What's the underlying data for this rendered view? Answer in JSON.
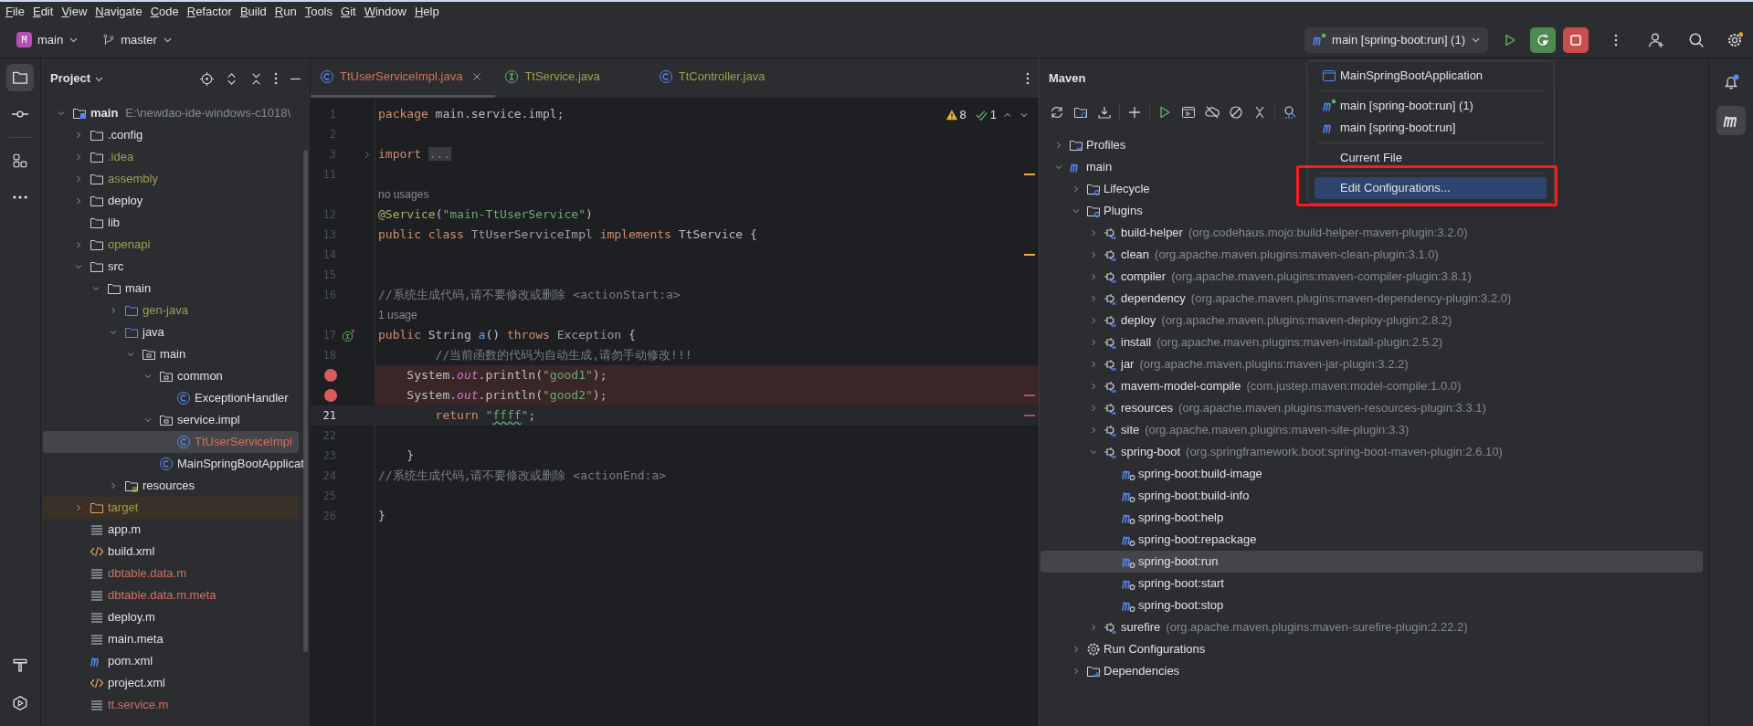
{
  "menu": [
    "File",
    "Edit",
    "View",
    "Navigate",
    "Code",
    "Refactor",
    "Build",
    "Run",
    "Tools",
    "Git",
    "Window",
    "Help"
  ],
  "toolbar": {
    "project": {
      "badge": "M",
      "label": "main"
    },
    "branch": "master",
    "run_config": "main [spring-boot:run] (1)",
    "running": true
  },
  "left_strip": [
    {
      "kind": "project",
      "selected": true
    },
    {
      "kind": "commit",
      "selected": false
    },
    {
      "kind": "structure",
      "selected": false
    },
    {
      "kind": "more",
      "selected": false
    }
  ],
  "left_strip_bottom": [
    {
      "kind": "build"
    },
    {
      "kind": "services"
    }
  ],
  "project": {
    "title": "Project",
    "tree": [
      {
        "kind": "module",
        "label": "main",
        "detail": "E:\\newdao-ide-windows-c1018\\",
        "expanded": true,
        "color": "#dfe1e5",
        "selected": false,
        "children": [
          {
            "kind": "folder",
            "label": ".config",
            "expanded": false,
            "color": "#dfe1e5",
            "selected": false
          },
          {
            "kind": "folder",
            "label": ".idea",
            "expanded": false,
            "color": "#a19f4e",
            "selected": false
          },
          {
            "kind": "folder",
            "label": "assembly",
            "expanded": false,
            "color": "#a19f4e",
            "selected": false
          },
          {
            "kind": "folder",
            "label": "deploy",
            "expanded": false,
            "color": "#dfe1e5",
            "selected": false
          },
          {
            "kind": "folder",
            "label": "lib",
            "color": "#dfe1e5",
            "selected": false
          },
          {
            "kind": "folder",
            "label": "openapi",
            "expanded": false,
            "color": "#a19f4e",
            "selected": false
          },
          {
            "kind": "folder",
            "label": "src",
            "expanded": true,
            "color": "#dfe1e5",
            "selected": false,
            "children": [
              {
                "kind": "folder",
                "label": "main",
                "expanded": true,
                "color": "#dfe1e5",
                "selected": false,
                "children": [
                  {
                    "kind": "source-folder",
                    "label": "gen-java",
                    "expanded": false,
                    "color": "#a19f4e",
                    "selected": false
                  },
                  {
                    "kind": "source-folder",
                    "label": "java",
                    "expanded": true,
                    "color": "#dfe1e5",
                    "selected": false,
                    "children": [
                      {
                        "kind": "package",
                        "label": "main",
                        "expanded": true,
                        "color": "#dfe1e5",
                        "selected": false,
                        "children": [
                          {
                            "kind": "package",
                            "label": "common",
                            "expanded": true,
                            "color": "#dfe1e5",
                            "selected": false,
                            "children": [
                              {
                                "kind": "class",
                                "label": "ExceptionHandler",
                                "color": "#dfe1e5",
                                "selected": false
                              }
                            ]
                          },
                          {
                            "kind": "package",
                            "label": "service.impl",
                            "expanded": true,
                            "color": "#dfe1e5",
                            "selected": false,
                            "children": [
                              {
                                "kind": "class",
                                "label": "TtUserServiceImpl",
                                "color": "#d5705e",
                                "selected": true
                              }
                            ]
                          },
                          {
                            "kind": "class",
                            "label": "MainSpringBootApplicat",
                            "color": "#dfe1e5",
                            "selected": false
                          }
                        ]
                      }
                    ]
                  },
                  {
                    "kind": "resources-folder",
                    "label": "resources",
                    "expanded": false,
                    "color": "#dfe1e5",
                    "selected": false
                  }
                ]
              }
            ]
          },
          {
            "kind": "excluded-folder",
            "label": "target",
            "expanded": false,
            "excluded": true,
            "color": "#a19f4e",
            "selected": false
          },
          {
            "kind": "file",
            "label": "app.m",
            "color": "#dfe1e5",
            "selected": false
          },
          {
            "kind": "xml",
            "label": "build.xml",
            "color": "#dfe1e5",
            "selected": false
          },
          {
            "kind": "file",
            "label": "dbtable.data.m",
            "color": "#d5705e",
            "selected": false
          },
          {
            "kind": "file",
            "label": "dbtable.data.m.meta",
            "color": "#d5705e",
            "selected": false
          },
          {
            "kind": "file",
            "label": "deploy.m",
            "color": "#dfe1e5",
            "selected": false
          },
          {
            "kind": "file",
            "label": "main.meta",
            "color": "#dfe1e5",
            "selected": false
          },
          {
            "kind": "maven",
            "label": "pom.xml",
            "color": "#dfe1e5",
            "selected": false
          },
          {
            "kind": "xml",
            "label": "project.xml",
            "color": "#dfe1e5",
            "selected": false
          },
          {
            "kind": "file",
            "label": "tt.service.m",
            "color": "#d5705e",
            "selected": false
          }
        ]
      }
    ]
  },
  "editor": {
    "tabs": [
      {
        "kind": "class",
        "label": "TtUserServiceImpl.java",
        "color": "#d5705e",
        "selected": true,
        "closable": true
      },
      {
        "kind": "interface",
        "label": "TtService.java",
        "color": "#a19f4e",
        "selected": false,
        "closable": false
      },
      {
        "kind": "class",
        "label": "TtController.java",
        "color": "#a19f4e",
        "selected": false,
        "closable": false
      }
    ],
    "inspections": {
      "warnings": "8",
      "passed": "1"
    },
    "lines": [
      {
        "kind": "code",
        "number": "1",
        "tokens": [
          {
            "kind": "keyword",
            "text": "package"
          },
          {
            "kind": "plain",
            "text": " main.service.impl;"
          }
        ]
      },
      {
        "kind": "code",
        "number": "2"
      },
      {
        "kind": "code",
        "number": "3",
        "fold": true,
        "tokens": [
          {
            "kind": "keyword",
            "text": "import "
          },
          {
            "kind": "fold",
            "text": "..."
          }
        ]
      },
      {
        "kind": "code",
        "number": "11",
        "warning_stripe": true
      },
      {
        "kind": "hint",
        "text": "no usages"
      },
      {
        "kind": "code",
        "number": "12",
        "tokens": [
          {
            "kind": "annotation",
            "text": "@Service"
          },
          {
            "kind": "plain",
            "text": "("
          },
          {
            "kind": "string",
            "text": "\"main-TtUserService\""
          },
          {
            "kind": "plain",
            "text": ")"
          }
        ]
      },
      {
        "kind": "code",
        "number": "13",
        "tokens": [
          {
            "kind": "keyword",
            "text": "public class "
          },
          {
            "kind": "dim",
            "text": "TtUserServiceImpl "
          },
          {
            "kind": "keyword",
            "text": "implements "
          },
          {
            "kind": "plain",
            "text": "TtService {"
          }
        ]
      },
      {
        "kind": "code",
        "number": "14",
        "warning_stripe": true
      },
      {
        "kind": "code",
        "number": "15"
      },
      {
        "kind": "code",
        "number": "16",
        "tokens": [
          {
            "kind": "comment",
            "text": "//系统生成代码,请不要修改或删除 <actionStart:a>"
          }
        ]
      },
      {
        "kind": "hint",
        "text": "1 usage"
      },
      {
        "kind": "code",
        "number": "17",
        "implements_marker": true,
        "tokens": [
          {
            "kind": "keyword",
            "text": "public "
          },
          {
            "kind": "plain",
            "text": "String "
          },
          {
            "kind": "method",
            "text": "a"
          },
          {
            "kind": "plain",
            "text": "() "
          },
          {
            "kind": "keyword",
            "text": "throws "
          },
          {
            "kind": "dim",
            "text": "Exception "
          },
          {
            "kind": "plain",
            "text": "{"
          }
        ]
      },
      {
        "kind": "code",
        "number": "18",
        "tokens": [
          {
            "kind": "comment",
            "text": "        //当前函数的代码为自动生成,请勿手动修改!!!"
          }
        ]
      },
      {
        "kind": "code",
        "breakpoint": true,
        "tokens": [
          {
            "kind": "plain",
            "text": "    System."
          },
          {
            "kind": "field",
            "text": "out"
          },
          {
            "kind": "plain",
            "text": ".println("
          },
          {
            "kind": "string",
            "text": "\"good1\""
          },
          {
            "kind": "plain",
            "text": ");"
          }
        ]
      },
      {
        "kind": "code",
        "breakpoint": true,
        "error_stripe": true,
        "tokens": [
          {
            "kind": "plain",
            "text": "    System."
          },
          {
            "kind": "field",
            "text": "out"
          },
          {
            "kind": "plain",
            "text": ".println("
          },
          {
            "kind": "string",
            "text": "\"good2\""
          },
          {
            "kind": "plain",
            "text": ");"
          }
        ]
      },
      {
        "kind": "code",
        "number": "21",
        "current": true,
        "error_stripe": true,
        "tokens": [
          {
            "kind": "keyword",
            "text": "        return "
          },
          {
            "kind": "string",
            "text": "\""
          },
          {
            "kind": "typo",
            "text": "ffff"
          },
          {
            "kind": "string",
            "text": "\""
          },
          {
            "kind": "plain",
            "text": ";"
          }
        ]
      },
      {
        "kind": "code",
        "number": "22"
      },
      {
        "kind": "code",
        "number": "23",
        "tokens": [
          {
            "kind": "plain",
            "text": "    }"
          }
        ]
      },
      {
        "kind": "code",
        "number": "24",
        "tokens": [
          {
            "kind": "comment",
            "text": "//系统生成代码,请不要修改或删除 <actionEnd:a>"
          }
        ]
      },
      {
        "kind": "code",
        "number": "25"
      },
      {
        "kind": "code",
        "number": "26",
        "tokens": [
          {
            "kind": "plain",
            "text": "}"
          }
        ]
      }
    ]
  },
  "maven": {
    "title": "Maven",
    "tools": [
      {
        "kind": "refresh"
      },
      {
        "kind": "reimport"
      },
      {
        "kind": "download"
      },
      {
        "kind": "add"
      },
      {
        "kind": "run"
      },
      {
        "kind": "run-config"
      },
      {
        "kind": "offline"
      },
      {
        "kind": "skip-tests"
      },
      {
        "kind": "collapse"
      },
      {
        "kind": "analyze"
      }
    ],
    "tree": [
      {
        "kind": "profiles",
        "label": "Profiles",
        "expanded": false,
        "selected": false
      },
      {
        "kind": "project",
        "label": "main",
        "expanded": true,
        "selected": false,
        "children": [
          {
            "kind": "lifecycle",
            "label": "Lifecycle",
            "expanded": false,
            "selected": false
          },
          {
            "kind": "plugins",
            "label": "Plugins",
            "expanded": true,
            "selected": false,
            "children": [
              {
                "kind": "plugin",
                "label": "build-helper",
                "detail": "(org.codehaus.mojo:build-helper-maven-plugin:3.2.0)",
                "expanded": false,
                "selected": false
              },
              {
                "kind": "plugin",
                "label": "clean",
                "detail": "(org.apache.maven.plugins:maven-clean-plugin:3.1.0)",
                "expanded": false,
                "selected": false
              },
              {
                "kind": "plugin",
                "label": "compiler",
                "detail": "(org.apache.maven.plugins:maven-compiler-plugin:3.8.1)",
                "expanded": false,
                "selected": false
              },
              {
                "kind": "plugin",
                "label": "dependency",
                "detail": "(org.apache.maven.plugins:maven-dependency-plugin:3.2.0)",
                "expanded": false,
                "selected": false
              },
              {
                "kind": "plugin",
                "label": "deploy",
                "detail": "(org.apache.maven.plugins:maven-deploy-plugin:2.8.2)",
                "expanded": false,
                "selected": false
              },
              {
                "kind": "plugin",
                "label": "install",
                "detail": "(org.apache.maven.plugins:maven-install-plugin:2.5.2)",
                "expanded": false,
                "selected": false
              },
              {
                "kind": "plugin",
                "label": "jar",
                "detail": "(org.apache.maven.plugins:maven-jar-plugin:3.2.2)",
                "expanded": false,
                "selected": false
              },
              {
                "kind": "plugin",
                "label": "mavem-model-compile",
                "detail": "(com.justep.maven:model-compile:1.0.0)",
                "expanded": false,
                "selected": false
              },
              {
                "kind": "plugin",
                "label": "resources",
                "detail": "(org.apache.maven.plugins:maven-resources-plugin:3.3.1)",
                "expanded": false,
                "selected": false
              },
              {
                "kind": "plugin",
                "label": "site",
                "detail": "(org.apache.maven.plugins:maven-site-plugin:3.3)",
                "expanded": false,
                "selected": false
              },
              {
                "kind": "plugin",
                "label": "spring-boot",
                "detail": "(org.springframework.boot:spring-boot-maven-plugin:2.6.10)",
                "expanded": true,
                "selected": false,
                "children": [
                  {
                    "kind": "goal",
                    "label": "spring-boot:build-image",
                    "selected": false
                  },
                  {
                    "kind": "goal",
                    "label": "spring-boot:build-info",
                    "selected": false
                  },
                  {
                    "kind": "goal",
                    "label": "spring-boot:help",
                    "selected": false
                  },
                  {
                    "kind": "goal",
                    "label": "spring-boot:repackage",
                    "selected": false
                  },
                  {
                    "kind": "goal",
                    "label": "spring-boot:run",
                    "selected": true
                  },
                  {
                    "kind": "goal",
                    "label": "spring-boot:start",
                    "selected": false
                  },
                  {
                    "kind": "goal",
                    "label": "spring-boot:stop",
                    "selected": false
                  }
                ]
              },
              {
                "kind": "plugin",
                "label": "surefire",
                "detail": "(org.apache.maven.plugins:maven-surefire-plugin:2.22.2)",
                "expanded": false,
                "selected": false
              }
            ]
          },
          {
            "kind": "run-configs",
            "label": "Run Configurations",
            "expanded": false,
            "selected": false
          },
          {
            "kind": "dependencies",
            "label": "Dependencies",
            "expanded": false,
            "selected": false
          }
        ]
      }
    ]
  },
  "run_menu": {
    "sections": [
      [
        {
          "kind": "app",
          "label": "MainSpringBootApplication",
          "selected": false,
          "highlighted": false
        }
      ],
      [
        {
          "kind": "maven-running",
          "label": "main [spring-boot:run] (1)",
          "selected": false,
          "highlighted": false
        },
        {
          "kind": "maven",
          "label": "main [spring-boot:run]",
          "selected": false,
          "highlighted": false
        }
      ],
      [
        {
          "kind": "plain",
          "label": "Current File",
          "selected": false,
          "highlighted": false
        }
      ],
      [
        {
          "kind": "plain",
          "label": "Edit Configurations...",
          "selected": true,
          "highlighted": true
        }
      ]
    ]
  },
  "right_strip": [
    {
      "kind": "notifications",
      "badge": true,
      "selected": false
    },
    {
      "kind": "maven",
      "selected": true
    }
  ]
}
